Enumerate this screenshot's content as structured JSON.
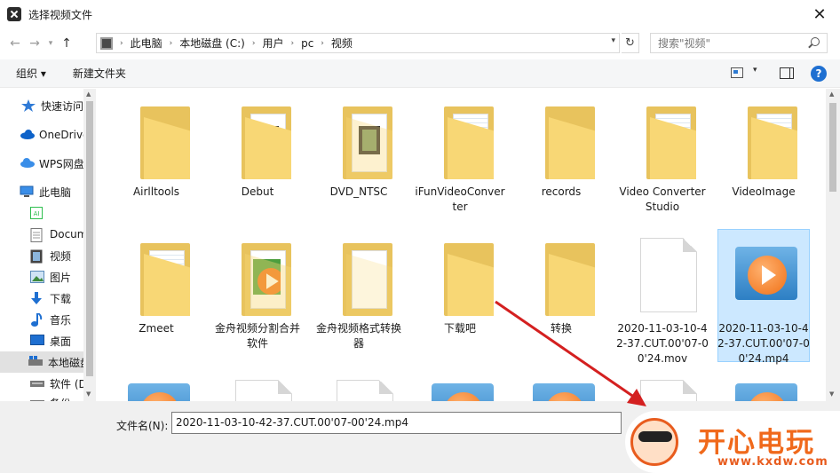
{
  "window": {
    "title": "选择视频文件",
    "close_glyph": "✕"
  },
  "address": {
    "breadcrumbs": [
      "此电脑",
      "本地磁盘 (C:)",
      "用户",
      "pc",
      "视频"
    ],
    "search_placeholder": "搜索\"视频\""
  },
  "toolbar": {
    "organize": "组织 ▾",
    "new_folder": "新建文件夹",
    "help": "?"
  },
  "sidebar": {
    "items": [
      {
        "label": "快速访问",
        "icon": "star-icon"
      },
      {
        "label": "OneDrive",
        "icon": "cloud-icon"
      },
      {
        "label": "WPS网盘",
        "icon": "cloud-wps-icon"
      },
      {
        "label": "此电脑",
        "icon": "computer-icon"
      },
      {
        "label": "",
        "icon": "app-icon-green"
      },
      {
        "label": "Documents",
        "icon": "document-icon"
      },
      {
        "label": "视频",
        "icon": "video-icon"
      },
      {
        "label": "图片",
        "icon": "picture-icon"
      },
      {
        "label": "下载",
        "icon": "download-icon"
      },
      {
        "label": "音乐",
        "icon": "music-icon"
      },
      {
        "label": "桌面",
        "icon": "desktop-icon"
      },
      {
        "label": "本地磁盘 (C:)",
        "icon": "drive-icon"
      },
      {
        "label": "软件 (D:)",
        "icon": "drive-icon"
      },
      {
        "label": "备份",
        "icon": "drive-icon"
      }
    ]
  },
  "files": [
    {
      "name": "Airlltools",
      "type": "folder"
    },
    {
      "name": "Debut",
      "type": "folder-video"
    },
    {
      "name": "DVD_NTSC",
      "type": "folder-video-white"
    },
    {
      "name": "iFunVideoConverter",
      "type": "folder-doc"
    },
    {
      "name": "records",
      "type": "folder"
    },
    {
      "name": "Video Converter Studio",
      "type": "folder-doc"
    },
    {
      "name": "VideoImage",
      "type": "folder-doc"
    },
    {
      "name": "Zmeet",
      "type": "folder-doc"
    },
    {
      "name": "金舟视频分割合并软件",
      "type": "folder-player"
    },
    {
      "name": "金舟视频格式转换器",
      "type": "folder-white"
    },
    {
      "name": "下载吧",
      "type": "folder"
    },
    {
      "name": "转换",
      "type": "folder"
    },
    {
      "name": "2020-11-03-10-42-37.CUT.00'07-00'24.mov",
      "type": "file"
    },
    {
      "name": "2020-11-03-10-42-37.CUT.00'07-00'24.mp4",
      "type": "player",
      "selected": true
    }
  ],
  "bottom": {
    "filename_label": "文件名(N):",
    "filename_value": "2020-11-03-10-42-37.CUT.00'07-00'24.mp4"
  },
  "watermark": {
    "title": "开心电玩",
    "url": "www.kxdw.com"
  },
  "colors": {
    "accent": "#1e6fd1",
    "selection": "#cce8ff",
    "arrow": "#d42020",
    "brand": "#f0691b"
  }
}
